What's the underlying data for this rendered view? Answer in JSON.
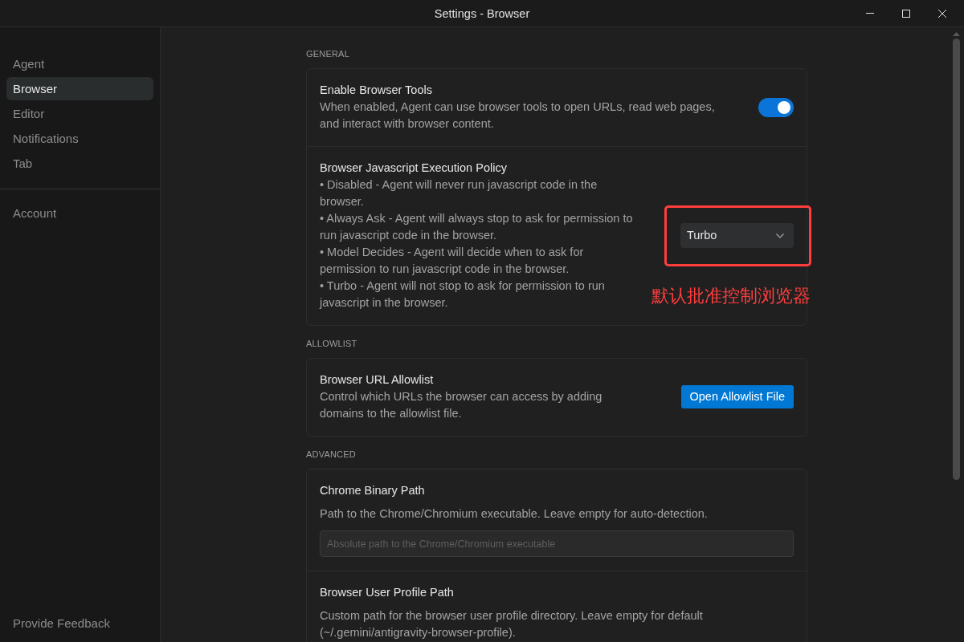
{
  "window": {
    "title": "Settings - Browser"
  },
  "sidebar": {
    "groups": [
      {
        "items": [
          {
            "label": "Agent",
            "selected": false
          },
          {
            "label": "Browser",
            "selected": true
          },
          {
            "label": "Editor",
            "selected": false
          },
          {
            "label": "Notifications",
            "selected": false
          },
          {
            "label": "Tab",
            "selected": false
          }
        ]
      },
      {
        "items": [
          {
            "label": "Account",
            "selected": false
          }
        ]
      }
    ],
    "footer_link": "Provide Feedback"
  },
  "sections": [
    {
      "title": "GENERAL",
      "settings": [
        {
          "kind": "toggle",
          "title": "Enable Browser Tools",
          "description": [
            "When enabled, Agent can use browser tools to open URLs, read web pages, and interact with browser content."
          ],
          "on": true
        },
        {
          "kind": "dropdown",
          "title": "Browser Javascript Execution Policy",
          "description": [
            "• Disabled - Agent will never run javascript code in the browser.",
            "• Always Ask - Agent will always stop to ask for permission to run javascript code in the browser.",
            "• Model Decides - Agent will decide when to ask for permission to run javascript code in the browser.",
            "• Turbo - Agent will not stop to ask for permission to run javascript in the browser."
          ],
          "value": "Turbo",
          "annotation": "默认批准控制浏览器"
        }
      ]
    },
    {
      "title": "ALLOWLIST",
      "settings": [
        {
          "kind": "button",
          "title": "Browser URL Allowlist",
          "description": [
            "Control which URLs the browser can access by adding domains to the allowlist file."
          ],
          "button": "Open Allowlist File"
        }
      ]
    },
    {
      "title": "ADVANCED",
      "settings": [
        {
          "kind": "input",
          "title": "Chrome Binary Path",
          "description": [
            "Path to the Chrome/Chromium executable. Leave empty for auto-detection."
          ],
          "placeholder": "Absolute path to the Chrome/Chromium executable"
        },
        {
          "kind": "text",
          "title": "Browser User Profile Path",
          "description": [
            "Custom path for the browser user profile directory. Leave empty for default (~/.gemini/antigravity-browser-profile)."
          ]
        }
      ]
    }
  ]
}
